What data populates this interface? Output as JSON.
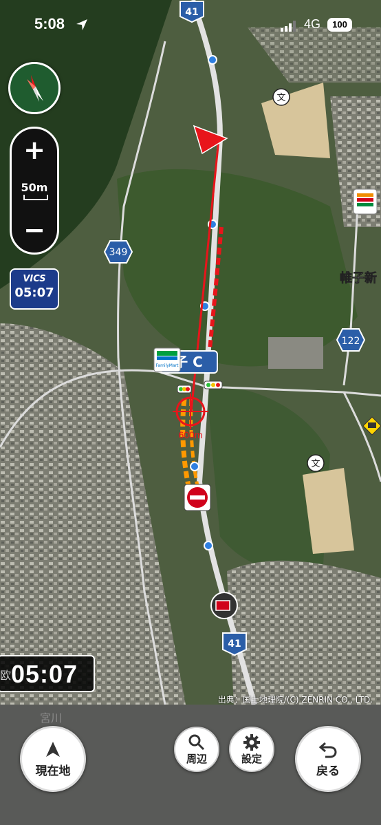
{
  "status_bar": {
    "time": "5:08",
    "network": "4G",
    "battery": "100"
  },
  "map": {
    "route_numbers": [
      "41",
      "349",
      "122",
      "41"
    ],
    "place_labels": {
      "ic_label": "子 C",
      "town_label": "帷子新",
      "familymart": "FamilyMart",
      "distance": "600m"
    },
    "colors": {
      "route_red": "#e8151b",
      "traffic_orange": "#ff9900",
      "road_white": "#e6e6e6",
      "shield_blue": "#2b5ea8"
    }
  },
  "controls": {
    "zoom_in": "+",
    "zoom_out": "−",
    "scale": "50m",
    "vics_label": "VICS",
    "vics_time": "05:07"
  },
  "time_panel": {
    "prefix": "欧",
    "time": "05:07"
  },
  "attribution": "出典：国土地理院/(C) ZENRIN CO., LTD.",
  "bottom_bar": {
    "faded_text": "宮川",
    "current_location": "現在地",
    "nearby": "周辺",
    "settings": "設定",
    "back": "戻る"
  }
}
